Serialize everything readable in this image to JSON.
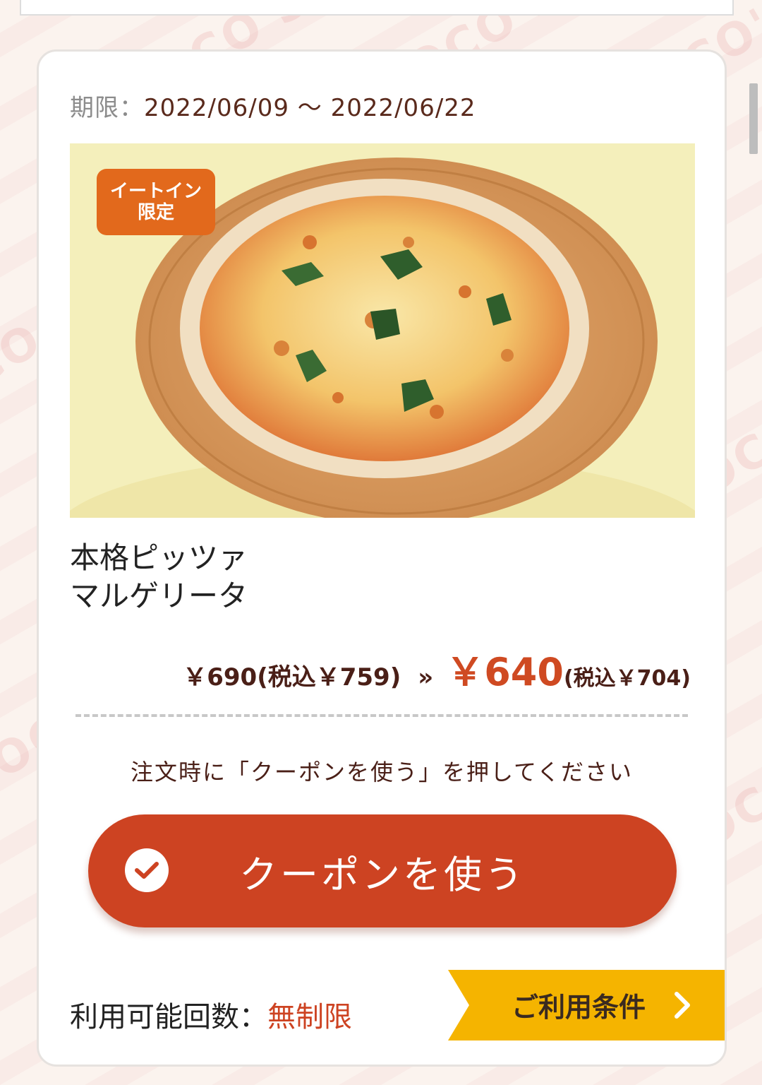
{
  "background": {
    "watermark_text": "COCO'S"
  },
  "coupon": {
    "period_label": "期限：",
    "period_value": "2022/06/09 〜 2022/06/22",
    "badge_line1": "イートイン",
    "badge_line2": "限定",
    "product_line1": "本格ピッツァ",
    "product_line2": "マルゲリータ",
    "old_price": "￥690(税込￥759)",
    "arrow": "»",
    "new_price": "￥640",
    "new_price_tax": "(税込￥704)",
    "instruction": "注文時に「クーポンを使う」を押してください",
    "use_button_label": "クーポンを使う",
    "usage_label": "利用可能回数：",
    "usage_value": "無制限",
    "terms_label": "ご利用条件"
  },
  "colors": {
    "accent": "#cd4322",
    "badge": "#e2691c",
    "tab": "#f5b400",
    "text_dark": "#4a1f17"
  },
  "icons": {
    "check": "check-icon",
    "chevron": "chevron-right-icon",
    "fork": "fork-icon",
    "spoon": "spoon-icon"
  }
}
